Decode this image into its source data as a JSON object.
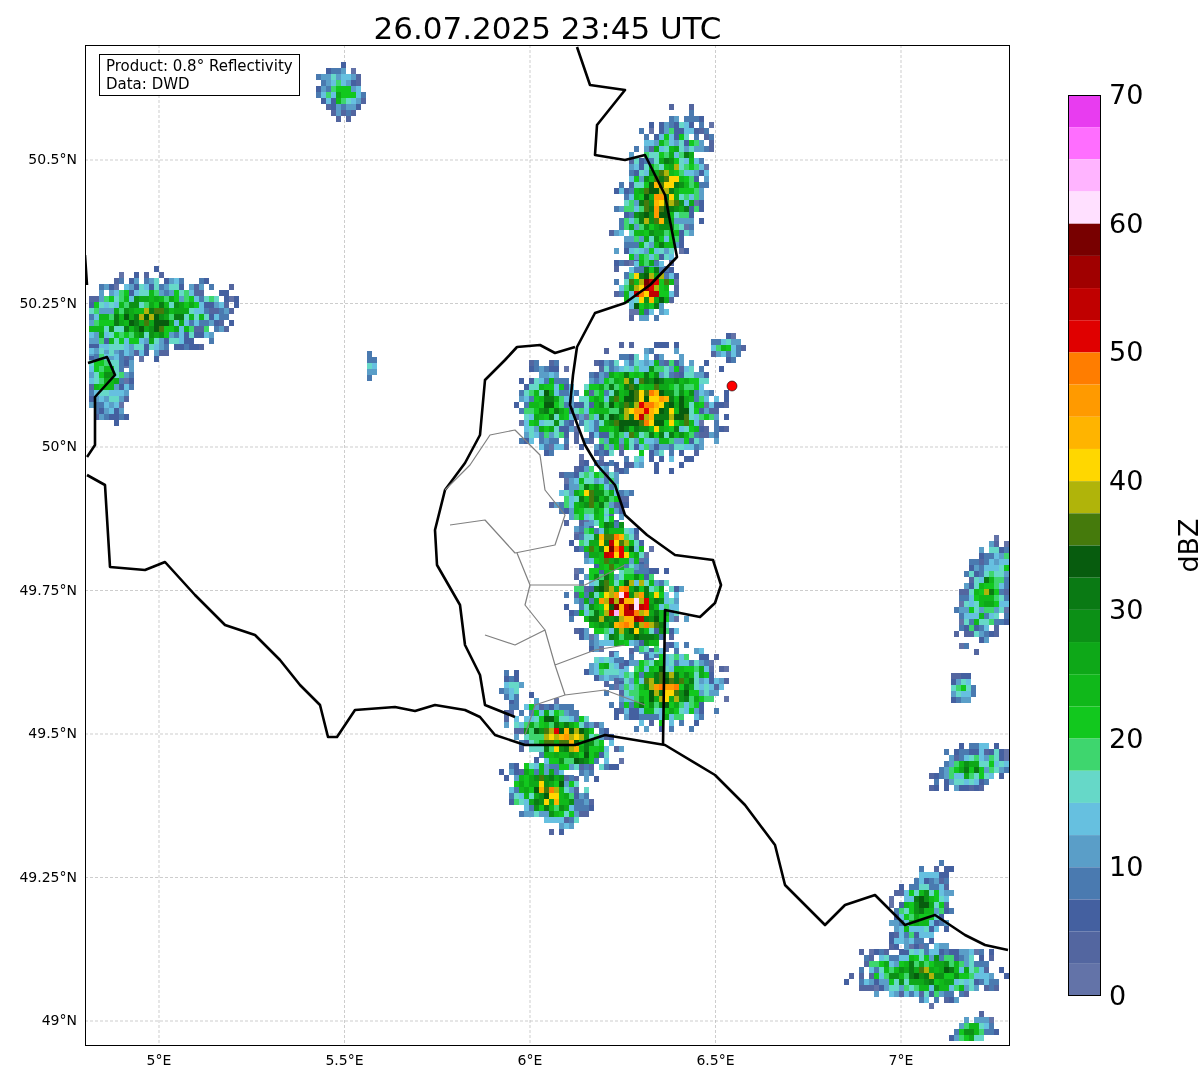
{
  "title": "26.07.2025 23:45 UTC",
  "legend": [
    "Product: 0.8° Reflectivity",
    "Data: DWD"
  ],
  "y_axis": {
    "ticks": [
      "50.5°N",
      "50.25°N",
      "50°N",
      "49.75°N",
      "49.5°N",
      "49.25°N",
      "49°N"
    ]
  },
  "x_axis": {
    "ticks": [
      "5°E",
      "5.5°E",
      "6°E",
      "6.5°E",
      "7°E"
    ]
  },
  "colorbar": {
    "label": "dBZ",
    "ticks": [
      "70",
      "60",
      "50",
      "40",
      "30",
      "20",
      "10",
      "0"
    ],
    "segments": [
      {
        "color": "#e83cf0"
      },
      {
        "color": "#ff6eff"
      },
      {
        "color": "#ffb4ff"
      },
      {
        "color": "#ffe0ff"
      },
      {
        "color": "#780000"
      },
      {
        "color": "#a00000"
      },
      {
        "color": "#c00000"
      },
      {
        "color": "#e00000"
      },
      {
        "color": "#ff7d00"
      },
      {
        "color": "#ff9a00"
      },
      {
        "color": "#ffb400"
      },
      {
        "color": "#ffd700"
      },
      {
        "color": "#b0b40a"
      },
      {
        "color": "#457a0c"
      },
      {
        "color": "#075c0e"
      },
      {
        "color": "#0a7a14"
      },
      {
        "color": "#0c9016"
      },
      {
        "color": "#0ea818"
      },
      {
        "color": "#10b81a"
      },
      {
        "color": "#12c81e"
      },
      {
        "color": "#3ed66e"
      },
      {
        "color": "#66d8c8"
      },
      {
        "color": "#66c0e0"
      },
      {
        "color": "#5a9ec8"
      },
      {
        "color": "#4a7ab0"
      },
      {
        "color": "#4460a0"
      },
      {
        "color": "#5366a0"
      },
      {
        "color": "#6373a8"
      }
    ]
  }
}
